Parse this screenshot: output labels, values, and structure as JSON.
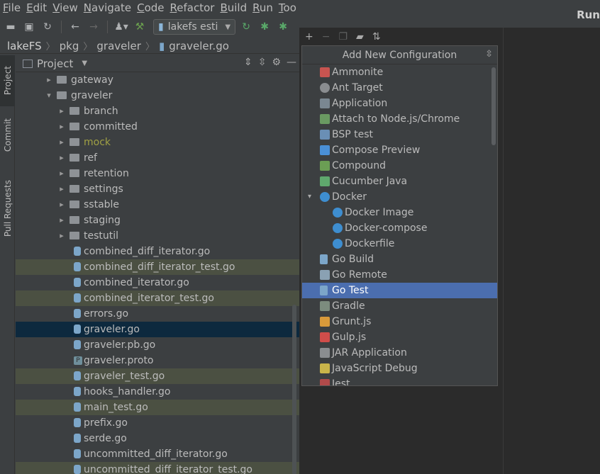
{
  "menu": {
    "items": [
      {
        "first": "F",
        "rest": "ile"
      },
      {
        "first": "E",
        "rest": "dit"
      },
      {
        "first": "V",
        "rest": "iew"
      },
      {
        "first": "N",
        "rest": "avigate"
      },
      {
        "first": "C",
        "rest": "ode"
      },
      {
        "first": "R",
        "rest": "efactor"
      },
      {
        "first": "B",
        "rest": "uild"
      },
      {
        "first": "R",
        "rest": "un"
      },
      {
        "first": "T",
        "rest": "oo"
      }
    ]
  },
  "toolbar": {
    "run_config_label": "lakefs esti"
  },
  "breadcrumb": [
    "lakeFS",
    "pkg",
    "graveler",
    "graveler.go"
  ],
  "toolstrip": {
    "project": "Project",
    "commit": "Commit",
    "pull_requests": "Pull Requests"
  },
  "project_panel": {
    "title": "Project",
    "tree": [
      {
        "name": "gateway",
        "type": "folder",
        "depth": 1,
        "expanded": false
      },
      {
        "name": "graveler",
        "type": "folder",
        "depth": 1,
        "expanded": true
      },
      {
        "name": "branch",
        "type": "folder",
        "depth": 2,
        "expanded": false
      },
      {
        "name": "committed",
        "type": "folder",
        "depth": 2,
        "expanded": false
      },
      {
        "name": "mock",
        "type": "folder",
        "depth": 2,
        "expanded": false,
        "excluded": true
      },
      {
        "name": "ref",
        "type": "folder",
        "depth": 2,
        "expanded": false
      },
      {
        "name": "retention",
        "type": "folder",
        "depth": 2,
        "expanded": false
      },
      {
        "name": "settings",
        "type": "folder",
        "depth": 2,
        "expanded": false
      },
      {
        "name": "sstable",
        "type": "folder",
        "depth": 2,
        "expanded": false
      },
      {
        "name": "staging",
        "type": "folder",
        "depth": 2,
        "expanded": false
      },
      {
        "name": "testutil",
        "type": "folder",
        "depth": 2,
        "expanded": false
      },
      {
        "name": "combined_diff_iterator.go",
        "type": "go",
        "depth": 2
      },
      {
        "name": "combined_diff_iterator_test.go",
        "type": "gotest",
        "depth": 2,
        "changed": true
      },
      {
        "name": "combined_iterator.go",
        "type": "go",
        "depth": 2
      },
      {
        "name": "combined_iterator_test.go",
        "type": "gotest",
        "depth": 2,
        "changed": true
      },
      {
        "name": "errors.go",
        "type": "go",
        "depth": 2
      },
      {
        "name": "graveler.go",
        "type": "go",
        "depth": 2,
        "selected": true
      },
      {
        "name": "graveler.pb.go",
        "type": "go",
        "depth": 2
      },
      {
        "name": "graveler.proto",
        "type": "proto",
        "depth": 2
      },
      {
        "name": "graveler_test.go",
        "type": "gotest",
        "depth": 2,
        "changed": true
      },
      {
        "name": "hooks_handler.go",
        "type": "go",
        "depth": 2
      },
      {
        "name": "main_test.go",
        "type": "gotest",
        "depth": 2,
        "changed": true
      },
      {
        "name": "prefix.go",
        "type": "go",
        "depth": 2
      },
      {
        "name": "serde.go",
        "type": "go",
        "depth": 2
      },
      {
        "name": "uncommitted_diff_iterator.go",
        "type": "go",
        "depth": 2
      },
      {
        "name": "uncommitted_diff_iterator_test.go",
        "type": "gotest",
        "depth": 2,
        "changed": true
      }
    ]
  },
  "run_dialog": {
    "title": "Run"
  },
  "popup": {
    "title": "Add New Configuration",
    "items": [
      {
        "label": "Ammonite",
        "icon": "ammonite-icon",
        "cls": "ico-ammonite",
        "indent": 0
      },
      {
        "label": "Ant Target",
        "icon": "ant-icon",
        "cls": "ico-ant",
        "indent": 0
      },
      {
        "label": "Application",
        "icon": "application-icon",
        "cls": "ico-app",
        "indent": 0
      },
      {
        "label": "Attach to Node.js/Chrome",
        "icon": "nodejs-attach-icon",
        "cls": "ico-node",
        "indent": 0
      },
      {
        "label": "BSP test",
        "icon": "bsp-icon",
        "cls": "ico-bsp",
        "indent": 0
      },
      {
        "label": "Compose Preview",
        "icon": "compose-icon",
        "cls": "ico-compose",
        "indent": 0
      },
      {
        "label": "Compound",
        "icon": "compound-icon",
        "cls": "ico-compound",
        "indent": 0
      },
      {
        "label": "Cucumber Java",
        "icon": "cucumber-icon",
        "cls": "ico-cucumber",
        "indent": 0
      },
      {
        "label": "Docker",
        "icon": "docker-icon",
        "cls": "ico-docker",
        "indent": 0,
        "expanded": true
      },
      {
        "label": "Docker Image",
        "icon": "docker-icon",
        "cls": "ico-docker",
        "indent": 1
      },
      {
        "label": "Docker-compose",
        "icon": "docker-icon",
        "cls": "ico-docker",
        "indent": 1
      },
      {
        "label": "Dockerfile",
        "icon": "docker-icon",
        "cls": "ico-docker",
        "indent": 1
      },
      {
        "label": "Go Build",
        "icon": "go-gopher-icon",
        "cls": "ico-go",
        "indent": 0
      },
      {
        "label": "Go Remote",
        "icon": "go-remote-icon",
        "cls": "ico-goremote",
        "indent": 0
      },
      {
        "label": "Go Test",
        "icon": "go-test-icon",
        "cls": "ico-go",
        "indent": 0,
        "selected": true
      },
      {
        "label": "Gradle",
        "icon": "gradle-icon",
        "cls": "ico-gradle",
        "indent": 0
      },
      {
        "label": "Grunt.js",
        "icon": "grunt-icon",
        "cls": "ico-grunt",
        "indent": 0
      },
      {
        "label": "Gulp.js",
        "icon": "gulp-icon",
        "cls": "ico-gulp",
        "indent": 0
      },
      {
        "label": "JAR Application",
        "icon": "jar-icon",
        "cls": "ico-jar",
        "indent": 0
      },
      {
        "label": "JavaScript Debug",
        "icon": "javascript-debug-icon",
        "cls": "ico-js",
        "indent": 0
      },
      {
        "label": "Jest",
        "icon": "jest-icon",
        "cls": "ico-jest",
        "indent": 0
      }
    ]
  }
}
